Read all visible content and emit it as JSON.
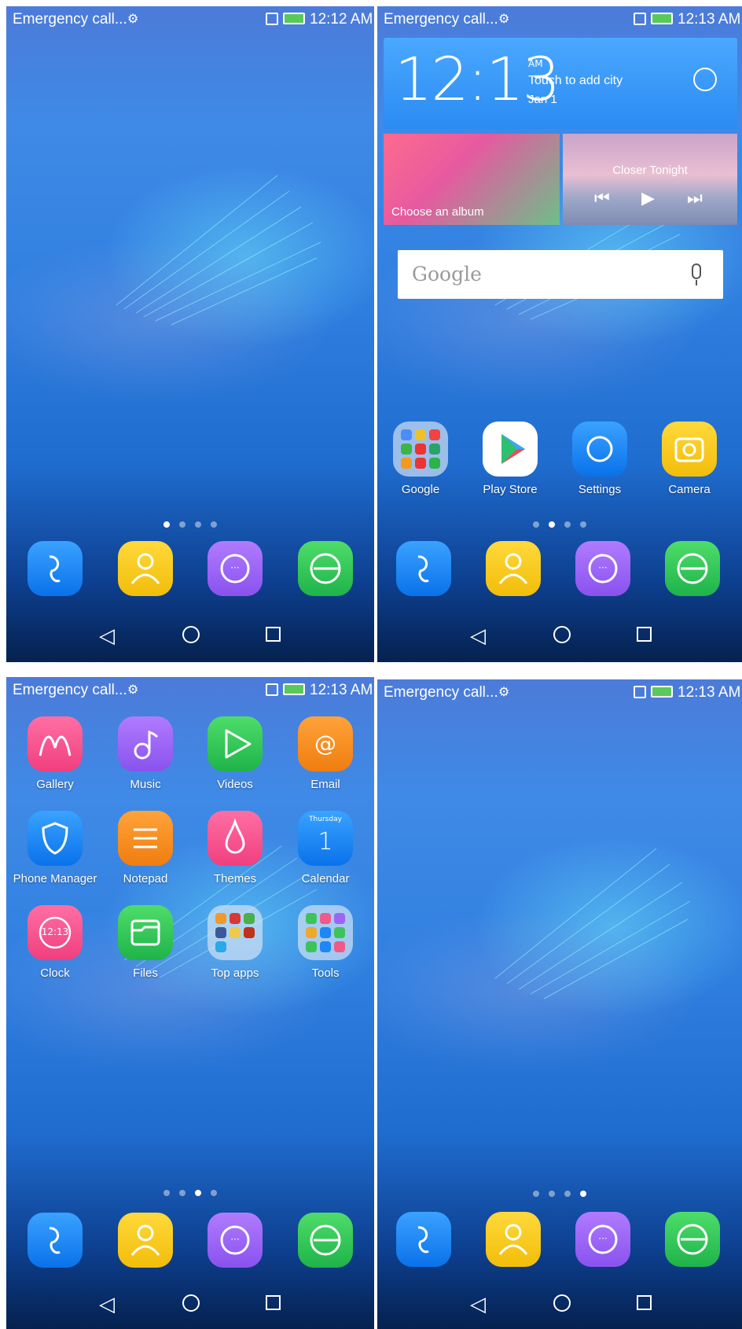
{
  "status_bar": {
    "emergency_text": "Emergency call...",
    "time_screen1": "12:12 AM",
    "time_other": "12:13 AM"
  },
  "dock": {
    "items": [
      {
        "icon": "phone-icon",
        "color": "#1e86f5"
      },
      {
        "icon": "contacts-icon",
        "color": "#f5c61e"
      },
      {
        "icon": "messaging-icon",
        "color": "#9b66f5"
      },
      {
        "icon": "browser-icon",
        "color": "#32c85a"
      }
    ]
  },
  "nav_bar": {
    "back": "◁",
    "home": "○",
    "recent": "□"
  },
  "screen1": {
    "page_dots": 4,
    "active_page": 1
  },
  "screen2": {
    "weather_widget": {
      "time": "12:13",
      "ampm": "AM",
      "city_prompt": "Touch to add city",
      "date": "Jan 1"
    },
    "album_widget": {
      "label": "Choose an album"
    },
    "music_widget": {
      "song": "Closer Tonight",
      "prev": "⏮",
      "play": "▶",
      "next": "⏭"
    },
    "google_search": {
      "logo_text": "Google"
    },
    "apps": [
      {
        "label": "Google",
        "icon": "google-folder-icon"
      },
      {
        "label": "Play Store",
        "icon": "play-store-icon"
      },
      {
        "label": "Settings",
        "icon": "settings-icon"
      },
      {
        "label": "Camera",
        "icon": "camera-icon"
      }
    ],
    "active_page": 2
  },
  "screen3": {
    "apps": [
      {
        "label": "Gallery",
        "icon": "gallery-icon"
      },
      {
        "label": "Music",
        "icon": "music-icon"
      },
      {
        "label": "Videos",
        "icon": "videos-icon"
      },
      {
        "label": "Email",
        "icon": "email-icon"
      },
      {
        "label": "Phone Manager",
        "icon": "phone-manager-icon"
      },
      {
        "label": "Notepad",
        "icon": "notepad-icon"
      },
      {
        "label": "Themes",
        "icon": "themes-icon"
      },
      {
        "label": "Calendar",
        "icon": "calendar-icon"
      },
      {
        "label": "Clock",
        "icon": "clock-icon"
      },
      {
        "label": "Files",
        "icon": "files-icon"
      },
      {
        "label": "Top apps",
        "icon": "top-apps-folder-icon"
      },
      {
        "label": "Tools",
        "icon": "tools-folder-icon"
      }
    ],
    "calendar_day": "Thursday",
    "calendar_date": "1",
    "clock_time": "12:13",
    "active_page": 3
  },
  "screen4": {
    "active_page": 4
  }
}
